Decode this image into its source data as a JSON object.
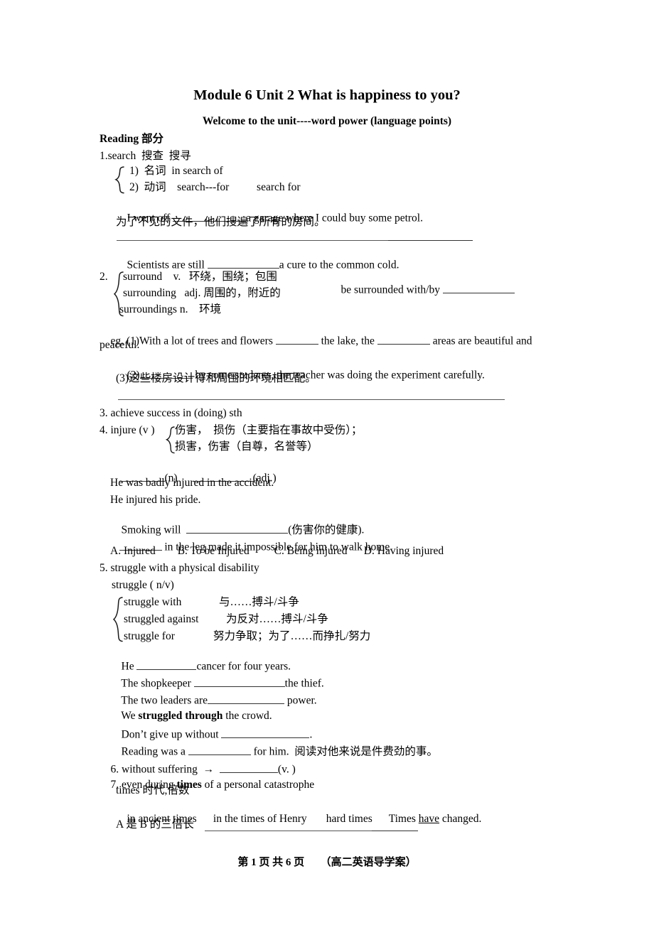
{
  "document": {
    "title": "Module 6 Unit 2 What is happiness to you?",
    "subtitle": "Welcome to the unit----word power (language points)",
    "section_heading": "Reading 部分"
  },
  "entries": {
    "e1": {
      "headword": "1.search  搜查  搜寻",
      "sub1": "1)  名词  in search of",
      "sub2": "2)  动词    search---for          search for",
      "ex1_a": "I went off ",
      "ex1_b": "a garage where I could buy some petrol.",
      "cn1": "为了不见的文件，他们搜遍了所有的房间。",
      "ex2_a": "Scientists are still ",
      "ex2_b": "a cure to the common cold."
    },
    "e2": {
      "num": "2.",
      "line1": "surround    v.   环绕，围绕；包围",
      "line1_right_a": "be surrounded with/by ",
      "line2": "surrounding   adj. 周围的，附近的",
      "line3": "surroundings n.    环境",
      "eg1_a": "eg. (1)With a lot of trees and flowers ",
      "eg1_b": " the lake, the ",
      "eg1_c": " areas are beautiful and",
      "eg1_d": "peaceful.",
      "eg2_a": "(2)",
      "eg2_b": " by some students, the teacher was doing the experiment carefully.",
      "eg3": "(3)这些楼房设计得和周围的环境相匹配。"
    },
    "e3": {
      "headword": "3. achieve success in (doing) sth"
    },
    "e4": {
      "headword": "4. injure (v )",
      "sense1": "伤害，  损伤（主要指在事故中受伤）；",
      "sense2": "损害，伤害（自尊，名誉等）",
      "forms_a": "(n)",
      "forms_b": "(adj.)",
      "ex1": "He was badly injured in the accident.",
      "ex2": "He injured his pride.",
      "ex3_a": "Smoking will  ",
      "ex3_b": "(伤害你的健康).",
      "ex4_b": " in the leg made it impossible for him to walk home.",
      "choices": "A. Injured        B. To be Injured         C. Being injured      D. Having injured"
    },
    "e5": {
      "headword": "5. struggle with a physical disability",
      "pos": "struggle ( n/v)",
      "phrase1_en": "struggle with",
      "phrase1_cn": "与……搏斗/斗争",
      "phrase2_en": "struggled against",
      "phrase2_cn": "为反对……搏斗/斗争",
      "phrase3_en": "struggle for",
      "phrase3_cn": "努力争取；为了……而挣扎/努力",
      "ex1_a": "He ",
      "ex1_b": "cancer for four years.",
      "ex2_a": "The shopkeeper ",
      "ex2_b": "the thief.",
      "ex3_a": "The two leaders are",
      "ex3_b": " power.",
      "ex4_a": "We ",
      "ex4_bold": "struggled through",
      "ex4_b": " the crowd.",
      "ex5_a": "Don’t give up without ",
      "ex5_b": ".",
      "ex6_a": "Reading was a ",
      "ex6_b": " for him.  阅读对他来说是件费劲的事。"
    },
    "e6": {
      "headword_a": "6. without suffering  →  ",
      "headword_b": "(v. )"
    },
    "e7": {
      "headword_a": "7. even during ",
      "headword_bold": "times",
      "headword_b": " of a personal catastrophe",
      "gloss": "times 时代,倍数",
      "examples_a": "in ancient times      in the times of Henry       hard times      Times ",
      "examples_u": "have",
      "examples_b": " changed.",
      "cn_note": "A 是 B 的三倍长"
    }
  },
  "footer": {
    "text": "第 1 页 共 6 页      （高二英语导学案）"
  },
  "colors": {
    "text": "#000000",
    "rule": "#555555",
    "background": "#ffffff"
  }
}
